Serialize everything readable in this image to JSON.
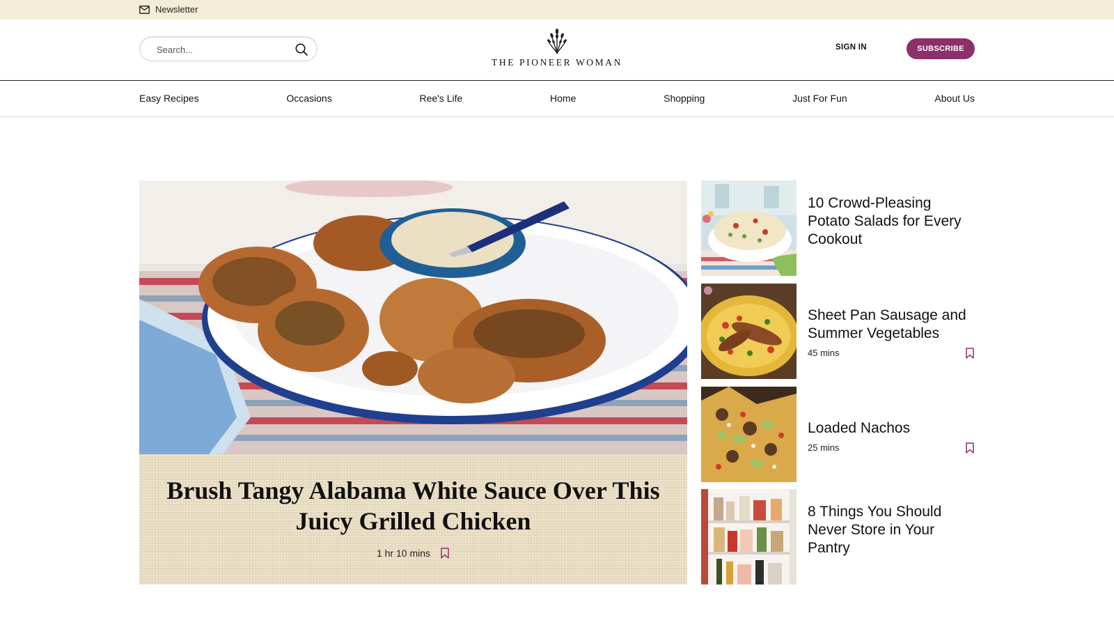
{
  "utility_bar": {
    "newsletter_label": "Newsletter",
    "icon": "mail-icon"
  },
  "header": {
    "search_placeholder": "Search...",
    "logo_text": "THE PIONEER WOMAN",
    "sign_in_label": "SIGN IN",
    "subscribe_label": "SUBSCRIBE"
  },
  "nav": {
    "items": [
      {
        "label": "Easy Recipes"
      },
      {
        "label": "Occasions"
      },
      {
        "label": "Ree's Life"
      },
      {
        "label": "Home"
      },
      {
        "label": "Shopping"
      },
      {
        "label": "Just For Fun"
      },
      {
        "label": "About Us"
      }
    ]
  },
  "hero": {
    "title": "Brush Tangy Alabama White Sauce Over This Juicy Grilled Chicken",
    "time": "1 hr 10 mins"
  },
  "side_cards": [
    {
      "title": "10 Crowd-Pleasing Potato Salads for Every Cookout"
    },
    {
      "title": "Sheet Pan Sausage and Summer Vegetables",
      "time": "45 mins"
    },
    {
      "title": "Loaded Nachos",
      "time": "25 mins"
    },
    {
      "title": "8 Things You Should Never Store in Your Pantry"
    }
  ],
  "colors": {
    "utility_bg": "#f3ecd6",
    "brand_accent": "#8c2f6b",
    "caption_bg": "#ede1c5"
  }
}
